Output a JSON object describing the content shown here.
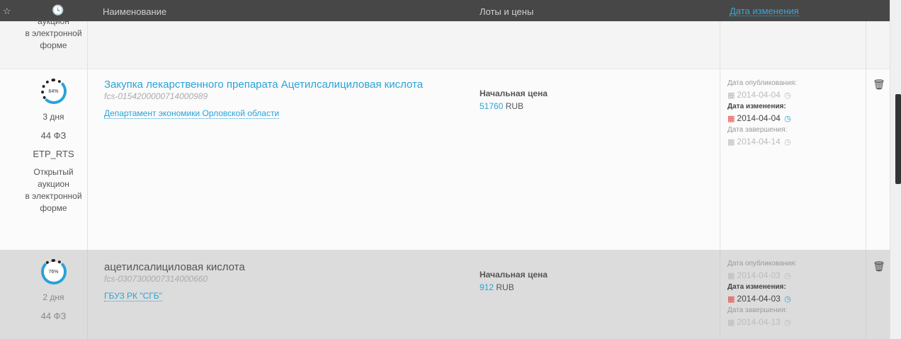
{
  "header": {
    "star": "☆",
    "clock": "🕓",
    "name": "Наименование",
    "lots": "Лоты и цены",
    "date_changed": "Дата изменения"
  },
  "rows": [
    {
      "info": [
        "аукцион",
        "в электронной",
        "форме"
      ]
    },
    {
      "progress": "64%",
      "progress_value": 0.64,
      "days": "3 дня",
      "law": "44 ФЗ",
      "platform": "ETP_RTS",
      "procedure": [
        "Открытый",
        "аукцион",
        "в электронной",
        "форме"
      ],
      "title": "Закупка лекарственного препарата Ацетилсалициловая кислота",
      "reg_number": "fcs-0154200000714000989",
      "customer": "Департамент экономики Орловской области",
      "price_label": "Начальная цена",
      "price": "51760",
      "currency": "RUB",
      "published_label": "Дата опубликования:",
      "published": "2014-04-04",
      "changed_label": "Дата изменения:",
      "changed": "2014-04-04",
      "end_label": "Дата завершения:",
      "end": "2014-04-14"
    },
    {
      "progress": "76%",
      "progress_value": 0.76,
      "days": "2 дня",
      "law": "44 ФЗ",
      "title": "ацетилсалициловая кислота",
      "reg_number": "fcs-0307300007314000660",
      "customer": "ГБУЗ РК \"СГБ\"",
      "price_label": "Начальная цена",
      "price": "912",
      "currency": "RUB",
      "published_label": "Дата опубликования:",
      "published": "2014-04-03",
      "changed_label": "Дата изменения:",
      "changed": "2014-04-03",
      "end_label": "Дата завершения:",
      "end": "2014-04-13"
    }
  ],
  "icons": {
    "calendar": "▦",
    "clock": "◷",
    "trash": "🗑"
  },
  "colors": {
    "accent": "#29a3d8",
    "header_bg": "#474747",
    "changed_calendar": "#e04848"
  }
}
